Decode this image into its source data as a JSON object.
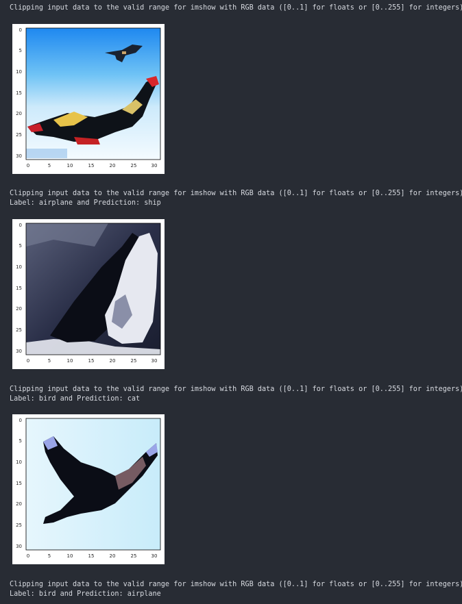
{
  "output": {
    "blocks": [
      {
        "lines": [
          "Clipping input data to the valid range for imshow with RGB data ([0..1] for floats or [0..255] for integers)."
        ]
      },
      {
        "lines": [
          "Clipping input data to the valid range for imshow with RGB data ([0..1] for floats or [0..255] for integers).",
          "Label: airplane and Prediction: ship"
        ]
      },
      {
        "lines": [
          "Clipping input data to the valid range for imshow with RGB data ([0..1] for floats or [0..255] for integers).",
          "Label: bird and Prediction: cat"
        ]
      },
      {
        "lines": [
          "Clipping input data to the valid range for imshow with RGB data ([0..1] for floats or [0..255] for integers).",
          "Label: bird and Prediction: airplane"
        ]
      }
    ],
    "figures": [
      {
        "description_icon": "image-plot",
        "xticks": [
          "0",
          "5",
          "10",
          "15",
          "20",
          "25",
          "30"
        ],
        "yticks": [
          "0",
          "5",
          "10",
          "15",
          "20",
          "25",
          "30"
        ]
      },
      {
        "description_icon": "image-plot",
        "xticks": [
          "0",
          "5",
          "10",
          "15",
          "20",
          "25",
          "30"
        ],
        "yticks": [
          "0",
          "5",
          "10",
          "15",
          "20",
          "25",
          "30"
        ]
      },
      {
        "description_icon": "image-plot",
        "xticks": [
          "0",
          "5",
          "10",
          "15",
          "20",
          "25",
          "30"
        ],
        "yticks": [
          "0",
          "5",
          "10",
          "15",
          "20",
          "25",
          "30"
        ]
      }
    ]
  }
}
